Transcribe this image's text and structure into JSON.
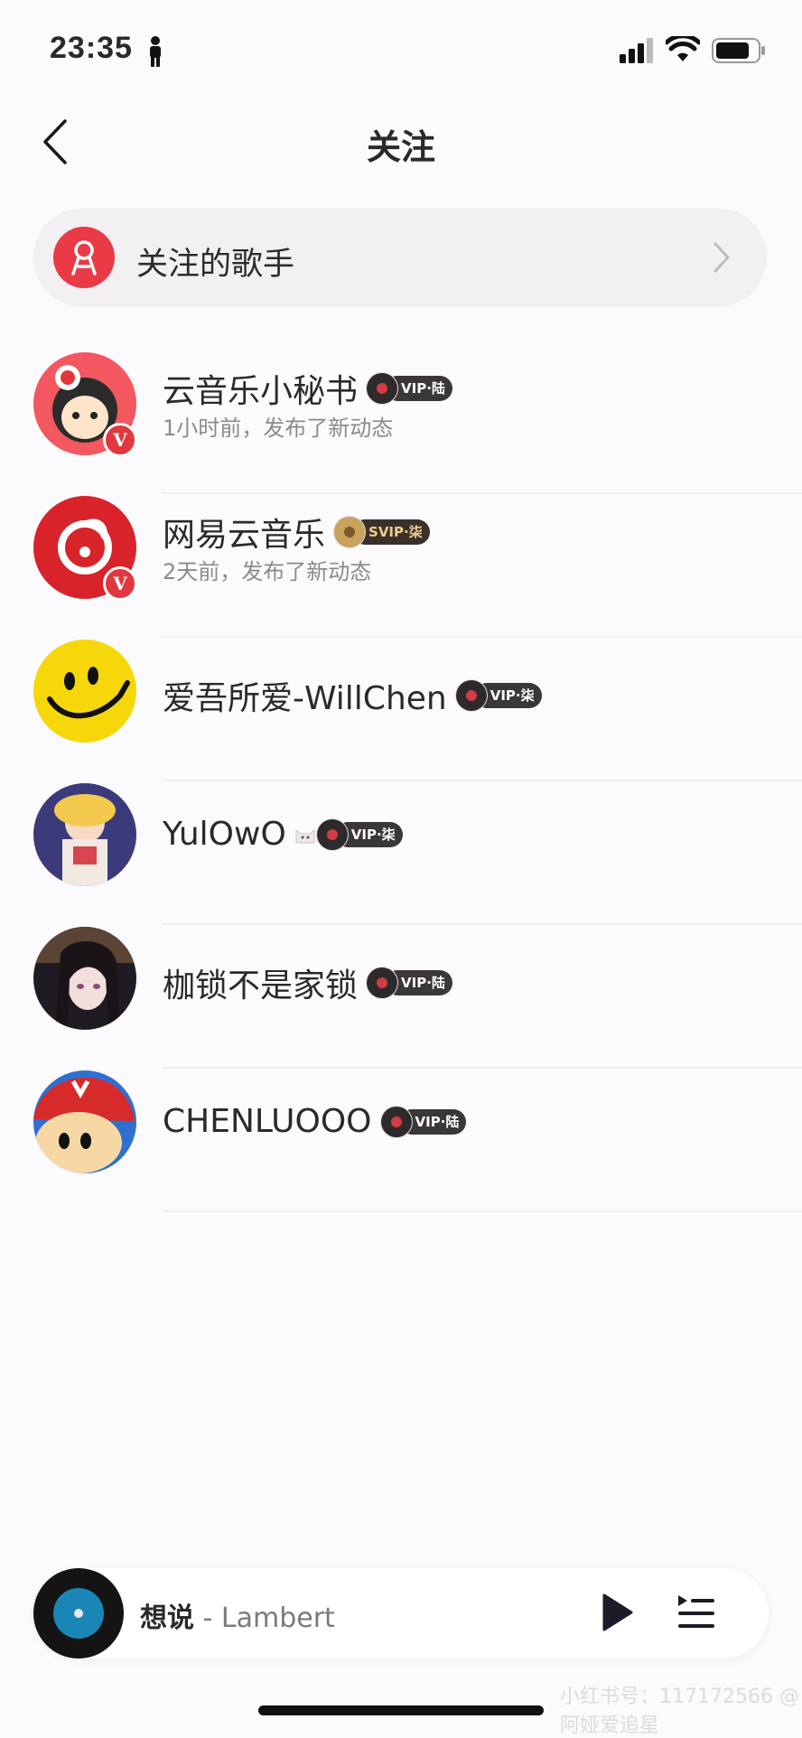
{
  "status_bar": {
    "time": "23:35"
  },
  "nav": {
    "title": "关注"
  },
  "followed_singers": {
    "label": "关注的歌手"
  },
  "users": [
    {
      "name": "云音乐小秘书",
      "vip": "VIP·陆",
      "subtitle": "1小时前，发布了新动态",
      "verified": true
    },
    {
      "name": "网易云音乐",
      "vip": "SVIP·柒",
      "subtitle": "2天前，发布了新动态",
      "verified": true
    },
    {
      "name": "爱吾所爱-WillChen",
      "vip": "VIP·柒",
      "subtitle": "",
      "verified": false
    },
    {
      "name": "YulOwO",
      "vip": "VIP·柒",
      "subtitle": "",
      "verified": false
    },
    {
      "name": "枷锁不是家锁",
      "vip": "VIP·陆",
      "subtitle": "",
      "verified": false
    },
    {
      "name": "CHENLUOOO",
      "vip": "VIP·陆",
      "subtitle": "",
      "verified": false
    }
  ],
  "verified_badge": "V",
  "player": {
    "song": "想说",
    "separator": " - ",
    "artist": "Lambert"
  },
  "watermark": "小红书号：117172566 @阿娅爱追星"
}
